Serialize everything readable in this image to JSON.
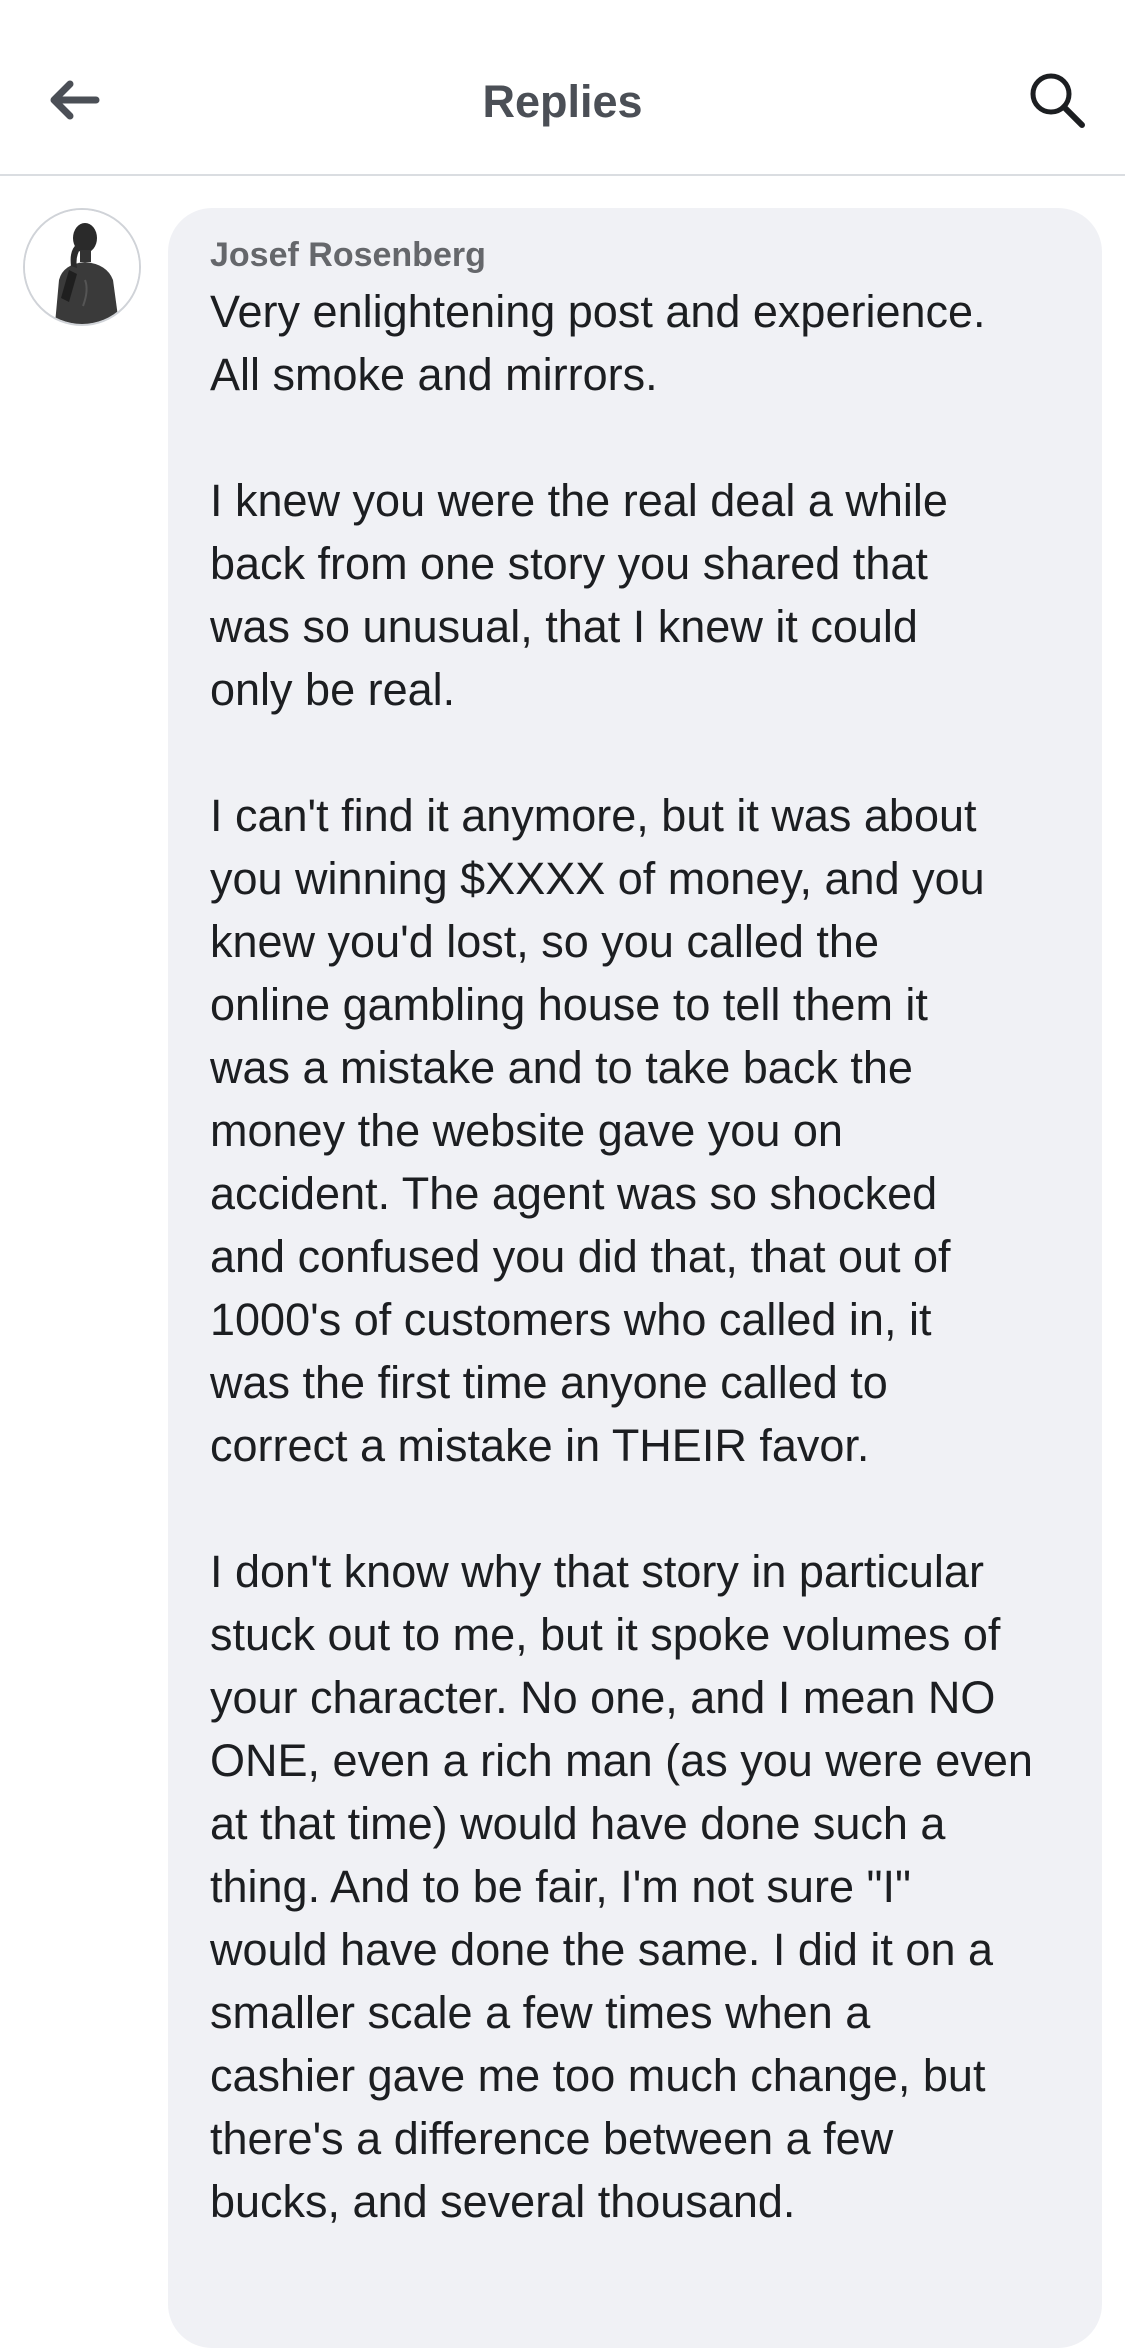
{
  "header": {
    "title": "Replies",
    "back_icon": "arrow-left-icon",
    "search_icon": "search-icon"
  },
  "comment": {
    "author": "Josef Rosenberg",
    "paragraphs": [
      "Very enlightening post and experience.\nAll smoke and mirrors.",
      "I knew you were the real deal a while\nback from one story you shared that\nwas so unusual, that I knew it could\nonly be real.",
      "I can't find it anymore, but it was about\nyou winning $XXXX of money, and you\nknew you'd lost, so you called the\nonline gambling house to tell them it\nwas a mistake and to take back the\nmoney the website gave you on\naccident. The agent was so shocked\nand confused you did that, that out of\n1000's of customers who called in, it\nwas the first time anyone called to\ncorrect a mistake in THEIR favor.",
      "I don't know why that story in particular\nstuck out to me, but it spoke volumes of\nyour character. No one, and I mean NO\nONE, even a rich man (as you were even\nat that time) would have done such a\nthing. And to be fair, I'm not sure \"I\"\nwould have done the same. I did it on a\nsmaller scale a few times when a\ncashier gave me too much change, but\nthere's a difference between a few\nbucks, and several thousand."
    ]
  },
  "colors": {
    "bubble_bg": "#f0f1f5",
    "author": "#65676b",
    "text": "#1c1e21",
    "header_title": "#4b4f56"
  }
}
